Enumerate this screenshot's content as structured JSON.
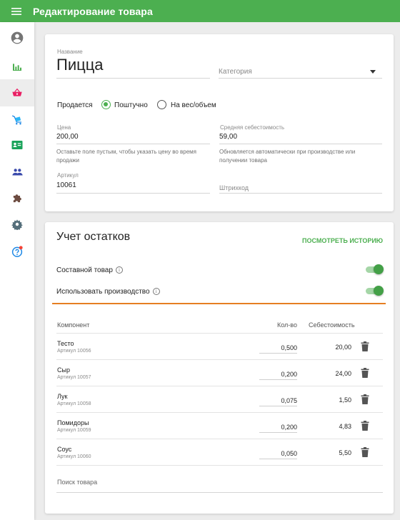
{
  "appbar": {
    "title": "Редактирование товара",
    "color": "#4caf50"
  },
  "sidebar": {
    "items": [
      {
        "icon": "account-circle-icon"
      },
      {
        "icon": "bar-chart-icon"
      },
      {
        "icon": "shopping-basket-icon",
        "active": true
      },
      {
        "icon": "cart-icon"
      },
      {
        "icon": "contact-card-icon"
      },
      {
        "icon": "people-icon"
      },
      {
        "icon": "puzzle-icon"
      },
      {
        "icon": "gear-icon"
      },
      {
        "icon": "help-icon",
        "badge": true
      }
    ]
  },
  "product": {
    "name_label": "Название",
    "name": "Пицца",
    "category_placeholder": "Категория",
    "sold_label": "Продается",
    "sold_options": [
      "Поштучно",
      "На вес/объем"
    ],
    "sold_selected": "Поштучно",
    "price_label": "Цена",
    "price": "200,00",
    "price_hint": "Оставьте поле пустым, чтобы указать цену во время продажи",
    "avg_cost_label": "Средняя себестоимость",
    "avg_cost": "59,00",
    "avg_cost_hint": "Обновляется автоматически при производстве или получении товара",
    "article_label": "Артикул",
    "article": "10061",
    "barcode_placeholder": "Штрихкод"
  },
  "stock": {
    "title": "Учет остатков",
    "history_link": "ПОСМОТРЕТЬ ИСТОРИЮ",
    "composite_label": "Составной товар",
    "composite_on": true,
    "production_label": "Использовать производство",
    "production_on": true,
    "highlight_color": "#e67e22",
    "columns": {
      "component": "Компонент",
      "qty": "Кол-во",
      "cost": "Себестоимость"
    },
    "rows": [
      {
        "name": "Тесто",
        "article": "Артикул 10056",
        "qty": "0,500",
        "cost": "20,00"
      },
      {
        "name": "Сыр",
        "article": "Артикул 10057",
        "qty": "0,200",
        "cost": "24,00"
      },
      {
        "name": "Лук",
        "article": "Артикул 10058",
        "qty": "0,075",
        "cost": "1,50"
      },
      {
        "name": "Помидоры",
        "article": "Артикул 10059",
        "qty": "0,200",
        "cost": "4,83"
      },
      {
        "name": "Соус",
        "article": "Артикул 10060",
        "qty": "0,050",
        "cost": "5,50"
      }
    ],
    "search_placeholder": "Поиск товара"
  }
}
